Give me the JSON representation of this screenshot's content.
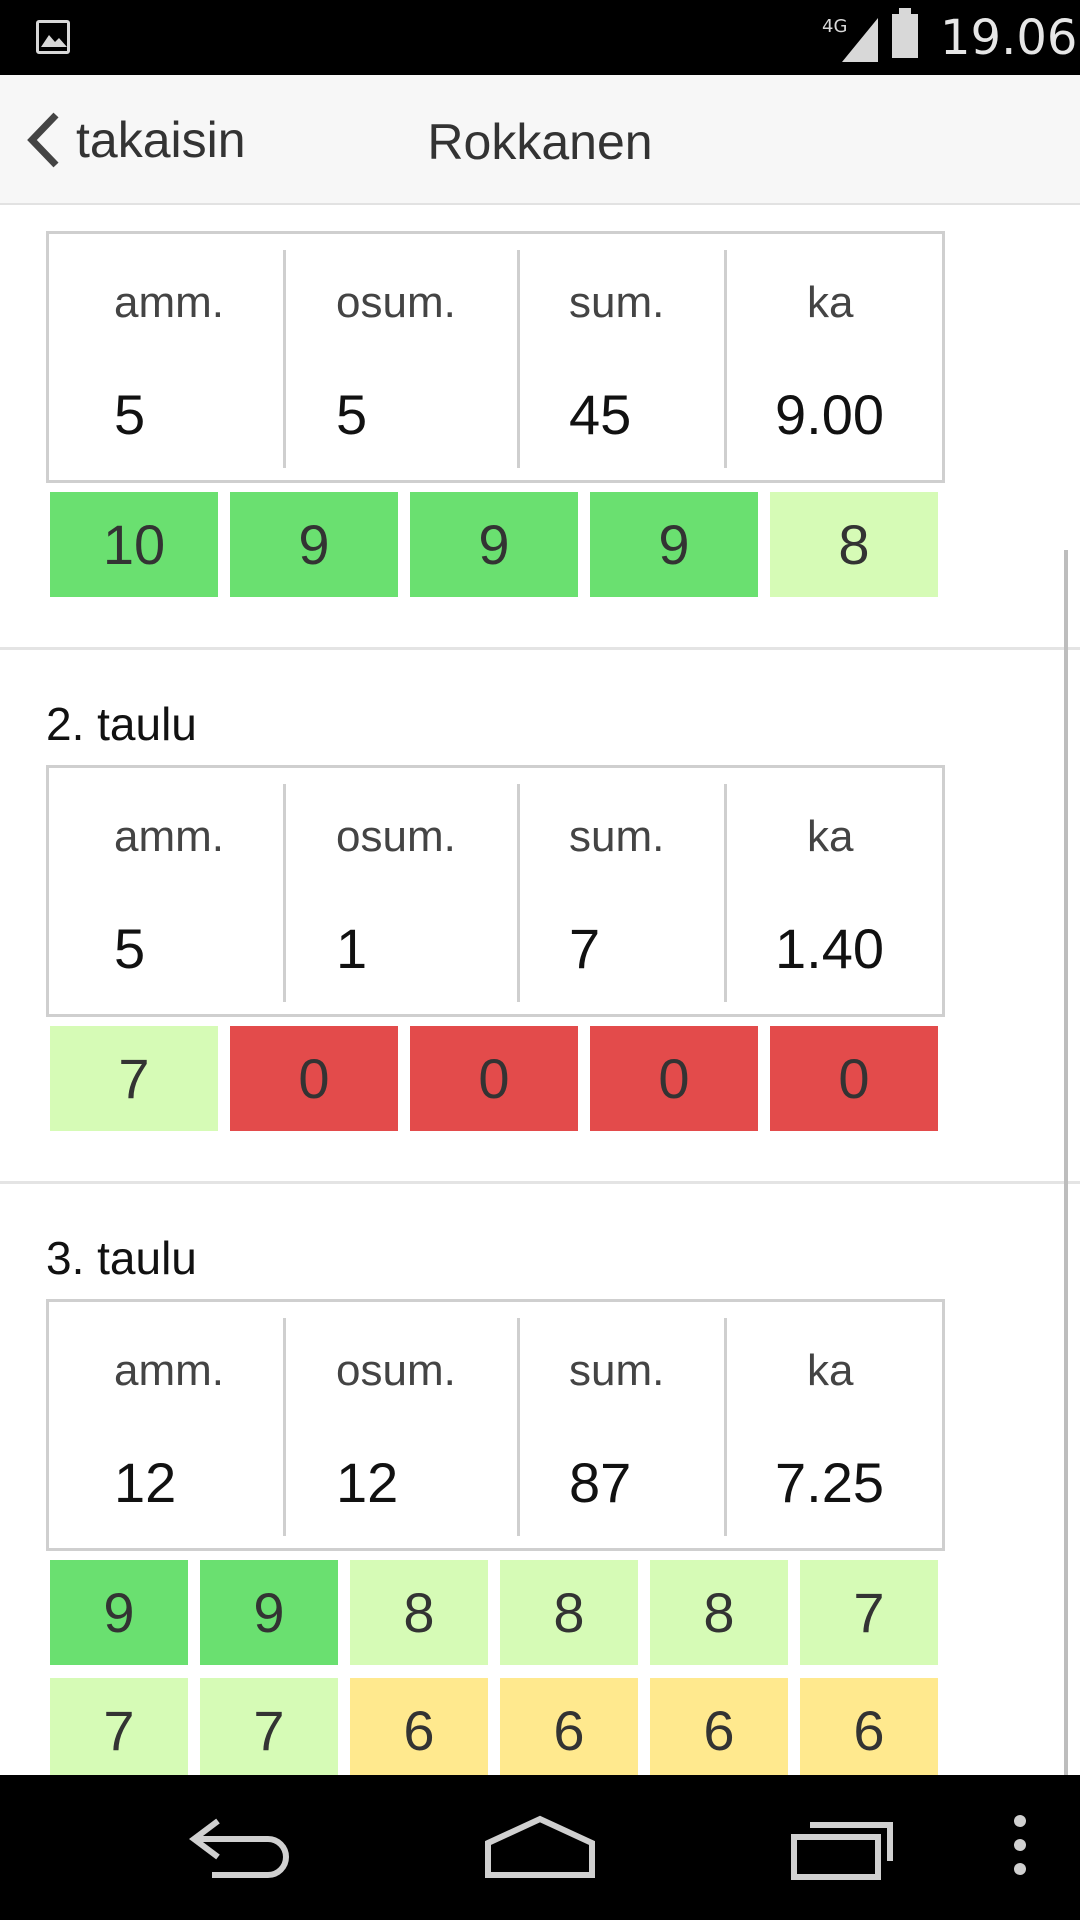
{
  "status_bar": {
    "network": "4G",
    "time": "19.06"
  },
  "header": {
    "back_label": "takaisin",
    "title": "Rokkanen"
  },
  "stat_labels": {
    "shots": "amm.",
    "hits": "osum.",
    "sum": "sum.",
    "avg": "ka"
  },
  "sections": [
    {
      "title": "",
      "shots": "5",
      "hits": "5",
      "sum": "45",
      "avg": "9.00",
      "scores": [
        "10",
        "9",
        "9",
        "9",
        "8"
      ]
    },
    {
      "title": "2. taulu",
      "shots": "5",
      "hits": "1",
      "sum": "7",
      "avg": "1.40",
      "scores": [
        "7",
        "0",
        "0",
        "0",
        "0"
      ]
    },
    {
      "title": "3. taulu",
      "shots": "12",
      "hits": "12",
      "sum": "87",
      "avg": "7.25",
      "scores": [
        "9",
        "9",
        "8",
        "8",
        "8",
        "7",
        "7",
        "7",
        "6",
        "6",
        "6",
        "6"
      ]
    }
  ],
  "score_colors": {
    "10": "#6ae070",
    "9": "#6ae070",
    "8": "#d6fbb6",
    "7": "#d6fbb6",
    "6": "#ffe98e",
    "0": "#e34b4b"
  }
}
